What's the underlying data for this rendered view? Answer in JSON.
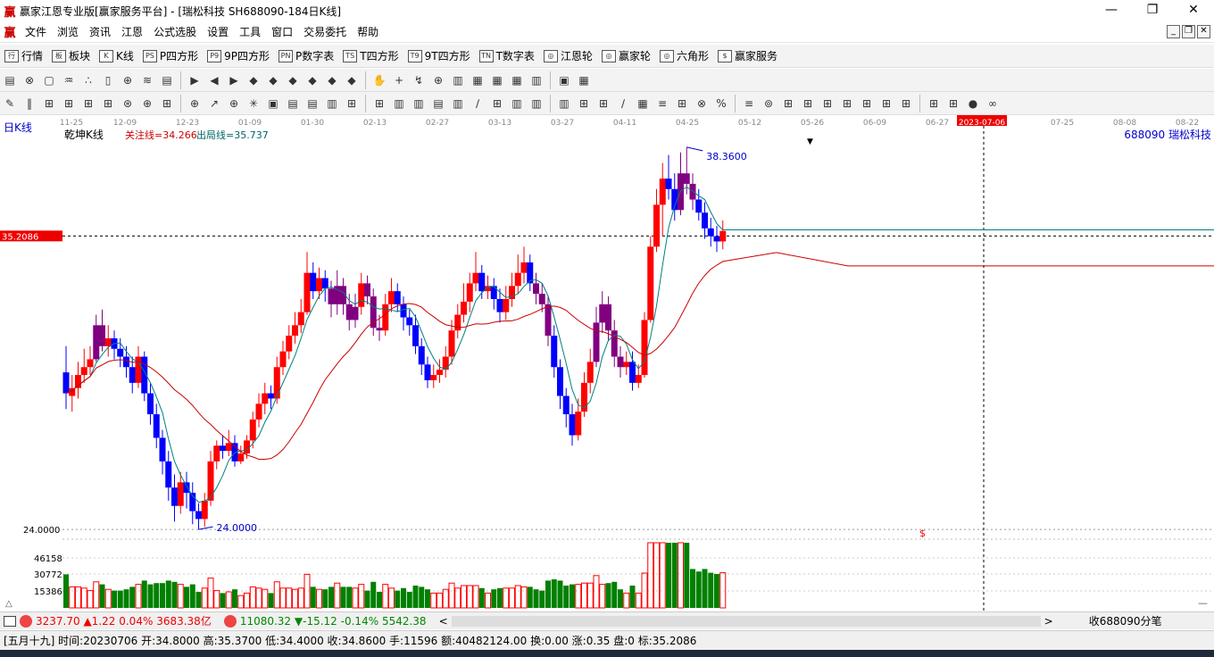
{
  "window": {
    "logo": "赢",
    "title": "赢家江恩专业版[赢家服务平台] - [瑞松科技   SH688090-184日K线]",
    "min": "—",
    "max": "❐",
    "close": "✕"
  },
  "menu": [
    "文件",
    "浏览",
    "资讯",
    "江恩",
    "公式选股",
    "设置",
    "工具",
    "窗口",
    "交易委托",
    "帮助"
  ],
  "toolbar1": [
    {
      "icon": "行",
      "label": "行情"
    },
    {
      "icon": "板",
      "label": "板块"
    },
    {
      "icon": "K",
      "label": "K线"
    },
    {
      "icon": "PS",
      "label": "P四方形"
    },
    {
      "icon": "P9",
      "label": "9P四方形"
    },
    {
      "icon": "PN",
      "label": "P数字表"
    },
    {
      "icon": "TS",
      "label": "T四方形"
    },
    {
      "icon": "T9",
      "label": "9T四方形"
    },
    {
      "icon": "TN",
      "label": "T数字表"
    },
    {
      "icon": "◎",
      "label": "江恩轮"
    },
    {
      "icon": "◎",
      "label": "赢家轮"
    },
    {
      "icon": "◎",
      "label": "六角形"
    },
    {
      "icon": "$",
      "label": "赢家服务"
    }
  ],
  "toolbar2_icons": [
    "▤",
    "⊗",
    "▢",
    "♒",
    "∴",
    "▯",
    "⊕",
    "≋",
    "▤",
    "▶",
    "◀",
    "▶",
    "◆",
    "◆",
    "◆",
    "◆",
    "◆",
    "◆",
    "✋",
    "+",
    "↯",
    "⊕",
    "▥",
    "▦",
    "▦",
    "▦",
    "▥",
    "▣",
    "▦"
  ],
  "toolbar3_icons": [
    "✎",
    "‖",
    "⊞",
    "⊞",
    "⊞",
    "⊞",
    "⊛",
    "⊕",
    "⊞",
    "⊕",
    "↗",
    "⊕",
    "✳",
    "▣",
    "▤",
    "▤",
    "▥",
    "⊞",
    "⊞",
    "▥",
    "▥",
    "▤",
    "▥",
    "∕",
    "⊞",
    "▥",
    "▥",
    "▥",
    "⊞",
    "⊞",
    "∕",
    "▦",
    "≡",
    "⊞",
    "⊗",
    "%",
    "≡",
    "⊚",
    "⊞",
    "⊞",
    "⊞",
    "⊞",
    "⊞",
    "⊞",
    "⊞",
    "⊞",
    "⊞",
    "●",
    "∞"
  ],
  "chart": {
    "period_label": "日K线",
    "indicator_name": "乾坤K线",
    "focus_line": "关注线=34.266",
    "exit_line": "出局线=35.737",
    "code_name": "688090  瑞松科技",
    "price_marker": "35.2086",
    "high_label": "38.3600",
    "low_label": "24.0000",
    "low_axis": "24.0000",
    "vol_axis": [
      "46158",
      "30772",
      "15386"
    ],
    "date_labels": [
      "11-25",
      "12-09",
      "12-23",
      "01-09",
      "01-30",
      "02-13",
      "02-27",
      "03-13",
      "03-27",
      "04-11",
      "04-25",
      "05-12",
      "05-26",
      "06-09",
      "06-27",
      "2023-07-06",
      "07-25",
      "08-08",
      "08-22"
    ],
    "highlighted_date": "2023-07-06",
    "dollar": "$",
    "colors": {
      "up": "#ff0000",
      "down": "#0000ff",
      "purple": "#800080",
      "ma1": "#008080",
      "ma2": "#cc0000",
      "volup": "#ff0000",
      "voldown": "#008000"
    }
  },
  "chart_data": {
    "type": "candlestick",
    "candles": [
      [
        30.0,
        29.2,
        31.0,
        28.6
      ],
      [
        29.1,
        29.4,
        29.9,
        28.5
      ],
      [
        29.4,
        29.9,
        30.4,
        29.0
      ],
      [
        29.9,
        30.2,
        30.9,
        29.6
      ],
      [
        30.2,
        30.5,
        31.0,
        29.9
      ],
      [
        30.5,
        31.8,
        32.2,
        30.4
      ],
      [
        31.8,
        31.0,
        32.4,
        30.8
      ],
      [
        31.0,
        31.3,
        31.8,
        30.6
      ],
      [
        31.3,
        30.9,
        31.6,
        30.5
      ],
      [
        30.9,
        30.6,
        31.3,
        30.2
      ],
      [
        30.6,
        30.2,
        31.0,
        29.8
      ],
      [
        30.2,
        29.6,
        30.6,
        29.2
      ],
      [
        29.6,
        30.6,
        31.0,
        29.4
      ],
      [
        30.6,
        29.2,
        30.8,
        28.9
      ],
      [
        29.2,
        28.4,
        29.6,
        28.0
      ],
      [
        28.4,
        27.5,
        28.8,
        27.1
      ],
      [
        27.5,
        26.6,
        27.8,
        26.1
      ],
      [
        26.6,
        25.6,
        27.0,
        25.1
      ],
      [
        25.6,
        24.9,
        26.1,
        24.3
      ],
      [
        24.9,
        25.8,
        26.2,
        24.6
      ],
      [
        25.8,
        25.4,
        26.2,
        24.8
      ],
      [
        25.4,
        24.7,
        25.8,
        24.2
      ],
      [
        24.7,
        24.4,
        25.0,
        24.0
      ],
      [
        24.4,
        25.1,
        25.4,
        24.1
      ],
      [
        25.1,
        26.6,
        27.0,
        24.9
      ],
      [
        26.6,
        27.2,
        27.4,
        26.3
      ],
      [
        27.2,
        27.0,
        27.6,
        26.7
      ],
      [
        27.0,
        27.3,
        27.8,
        26.8
      ],
      [
        27.3,
        26.6,
        27.6,
        26.4
      ],
      [
        26.6,
        26.9,
        27.2,
        26.5
      ],
      [
        26.9,
        27.4,
        27.6,
        26.7
      ],
      [
        27.4,
        28.2,
        28.5,
        27.1
      ],
      [
        28.2,
        28.8,
        29.2,
        27.9
      ],
      [
        28.8,
        29.2,
        29.6,
        28.4
      ],
      [
        29.2,
        29.0,
        29.5,
        28.6
      ],
      [
        29.0,
        30.2,
        30.6,
        28.8
      ],
      [
        30.2,
        30.8,
        31.2,
        29.9
      ],
      [
        30.8,
        31.4,
        31.8,
        30.5
      ],
      [
        31.4,
        31.8,
        32.3,
        31.1
      ],
      [
        31.8,
        32.3,
        32.8,
        31.5
      ],
      [
        32.3,
        33.8,
        34.6,
        32.2
      ],
      [
        33.8,
        33.1,
        34.2,
        32.8
      ],
      [
        33.1,
        33.6,
        34.0,
        32.8
      ],
      [
        33.6,
        33.2,
        33.9,
        32.7
      ],
      [
        33.2,
        32.6,
        33.5,
        32.1
      ],
      [
        32.6,
        33.3,
        33.9,
        32.2
      ],
      [
        33.3,
        32.6,
        33.6,
        32.2
      ],
      [
        32.6,
        32.0,
        33.0,
        31.6
      ],
      [
        32.0,
        32.5,
        33.0,
        31.7
      ],
      [
        32.5,
        33.4,
        33.8,
        32.2
      ],
      [
        33.4,
        32.9,
        33.7,
        32.6
      ],
      [
        32.9,
        31.7,
        33.2,
        31.4
      ],
      [
        31.7,
        31.6,
        32.2,
        31.2
      ],
      [
        31.6,
        32.6,
        33.0,
        31.4
      ],
      [
        32.6,
        33.1,
        33.6,
        32.3
      ],
      [
        33.1,
        32.6,
        33.4,
        32.3
      ],
      [
        32.6,
        32.1,
        32.9,
        31.6
      ],
      [
        32.1,
        31.8,
        32.4,
        31.4
      ],
      [
        31.8,
        31.0,
        32.2,
        30.7
      ],
      [
        31.0,
        30.3,
        31.3,
        29.9
      ],
      [
        30.3,
        29.7,
        30.6,
        29.4
      ],
      [
        29.7,
        29.9,
        30.3,
        29.4
      ],
      [
        29.9,
        30.1,
        30.5,
        29.6
      ],
      [
        30.1,
        30.6,
        31.0,
        29.8
      ],
      [
        30.6,
        31.6,
        32.0,
        30.3
      ],
      [
        31.6,
        32.2,
        32.6,
        31.3
      ],
      [
        32.2,
        32.7,
        33.4,
        31.9
      ],
      [
        32.7,
        33.4,
        33.8,
        32.3
      ],
      [
        33.4,
        33.8,
        34.6,
        33.1
      ],
      [
        33.8,
        33.1,
        34.1,
        32.8
      ],
      [
        33.1,
        33.3,
        33.7,
        32.8
      ],
      [
        33.3,
        32.8,
        33.6,
        32.4
      ],
      [
        32.8,
        32.3,
        33.2,
        31.9
      ],
      [
        32.3,
        32.8,
        33.3,
        32.0
      ],
      [
        32.8,
        33.3,
        33.8,
        32.5
      ],
      [
        33.3,
        33.8,
        34.5,
        33.0
      ],
      [
        33.8,
        34.2,
        34.8,
        33.4
      ],
      [
        34.2,
        33.4,
        34.5,
        33.1
      ],
      [
        33.4,
        33.0,
        33.8,
        32.6
      ],
      [
        33.0,
        32.6,
        33.4,
        32.3
      ],
      [
        32.6,
        31.4,
        32.9,
        31.0
      ],
      [
        31.4,
        30.2,
        31.8,
        29.8
      ],
      [
        30.2,
        29.1,
        30.5,
        28.6
      ],
      [
        29.1,
        28.4,
        29.4,
        27.9
      ],
      [
        28.4,
        27.6,
        28.8,
        27.2
      ],
      [
        27.6,
        28.5,
        29.0,
        27.4
      ],
      [
        28.5,
        29.6,
        30.0,
        28.3
      ],
      [
        29.6,
        30.4,
        30.9,
        29.2
      ],
      [
        30.4,
        31.9,
        32.5,
        30.2
      ],
      [
        31.9,
        32.6,
        33.1,
        31.5
      ],
      [
        32.6,
        31.6,
        32.9,
        31.2
      ],
      [
        31.6,
        30.6,
        32.0,
        30.2
      ],
      [
        30.6,
        30.2,
        31.0,
        29.8
      ],
      [
        30.2,
        30.4,
        30.8,
        29.9
      ],
      [
        30.4,
        29.6,
        30.8,
        29.3
      ],
      [
        29.6,
        29.9,
        30.3,
        29.4
      ],
      [
        29.9,
        32.0,
        32.3,
        29.8
      ],
      [
        32.0,
        34.8,
        35.2,
        31.9
      ],
      [
        34.8,
        36.4,
        37.0,
        34.6
      ],
      [
        36.4,
        37.4,
        38.0,
        35.2
      ],
      [
        37.4,
        37.0,
        38.3,
        36.6
      ],
      [
        37.0,
        36.2,
        37.6,
        35.8
      ],
      [
        36.2,
        37.6,
        38.4,
        36.0
      ],
      [
        37.6,
        37.2,
        38.6,
        36.8
      ],
      [
        37.2,
        36.6,
        37.6,
        36.2
      ],
      [
        36.6,
        36.1,
        37.0,
        35.8
      ],
      [
        36.1,
        35.5,
        36.5,
        35.1
      ],
      [
        35.5,
        35.2,
        35.9,
        34.8
      ],
      [
        35.2,
        35.0,
        35.6,
        34.6
      ],
      [
        35.0,
        35.4,
        35.8,
        34.7
      ]
    ],
    "price_high": 38.36,
    "price_low": 24.0,
    "series": [
      {
        "name": "关注线"
      },
      {
        "name": "出局线"
      }
    ]
  },
  "bottom1": {
    "sh_label": "3237.70",
    "sh_change": "▲1.22",
    "sh_pct": "0.04%",
    "sh_amount": "3683.38亿",
    "sz_label": "11080.32",
    "sz_change": "▼-15.12",
    "sz_pct": "-0.14%",
    "sz_amount": "5542.38",
    "right_text": "收688090分笔"
  },
  "bottom2": {
    "text": "[五月十九] 时间:20230706 开:34.8000 高:35.3700 低:34.4000 收:34.8600 手:11596 额:40482124.00 换:0.00 涨:0.35 盘:0 标:35.2086"
  }
}
